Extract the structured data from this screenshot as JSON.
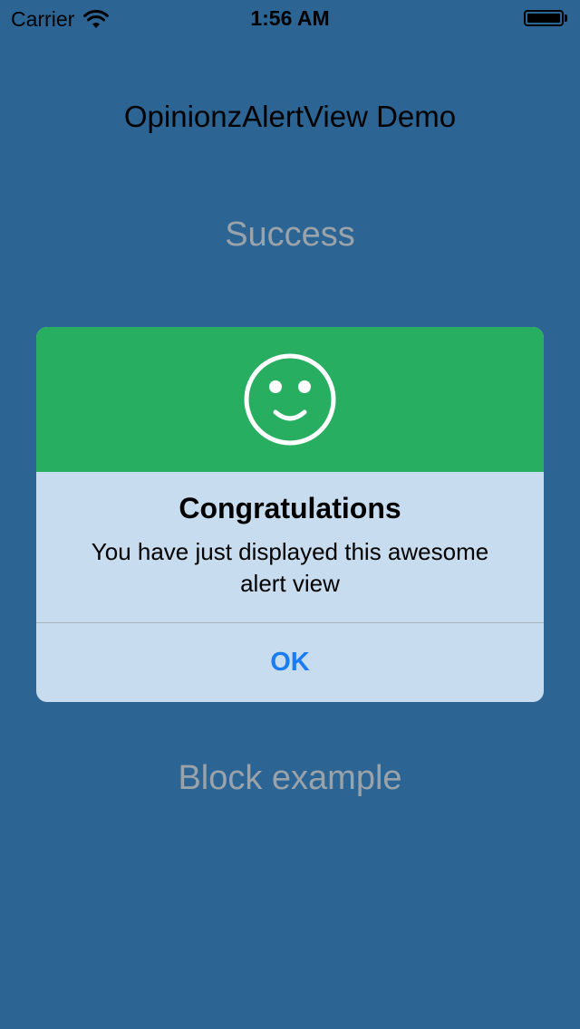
{
  "status_bar": {
    "carrier": "Carrier",
    "time": "1:56 AM"
  },
  "app": {
    "title": "OpinionzAlertView Demo",
    "success_button": "Success",
    "block_example_button": "Block example"
  },
  "alert": {
    "icon": "smiley-icon",
    "header_color": "#27ae60",
    "title": "Congratulations",
    "message": "You have just displayed this awesome alert view",
    "ok_label": "OK"
  },
  "colors": {
    "background": "#2c6594",
    "alert_body": "#c7dcee",
    "ok_text": "#1a7cf0"
  }
}
